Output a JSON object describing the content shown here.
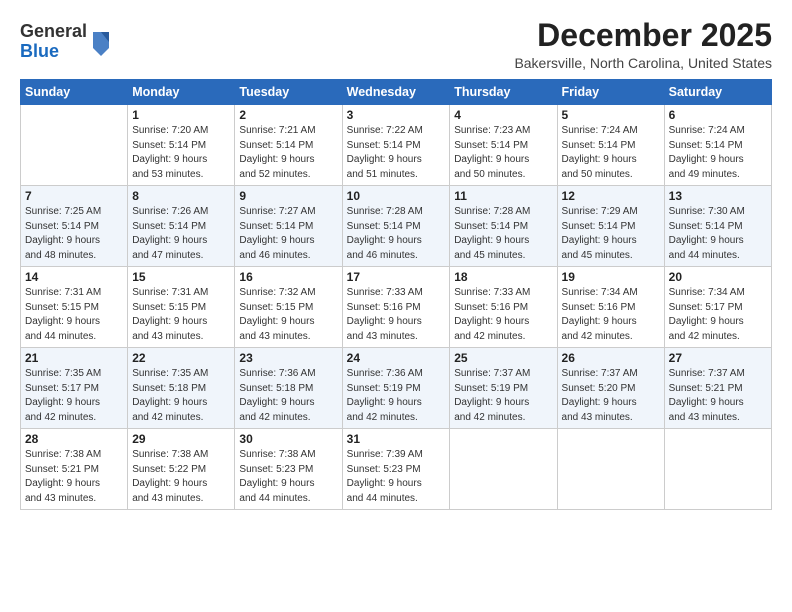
{
  "header": {
    "logo_general": "General",
    "logo_blue": "Blue",
    "month_title": "December 2025",
    "location": "Bakersville, North Carolina, United States"
  },
  "weekdays": [
    "Sunday",
    "Monday",
    "Tuesday",
    "Wednesday",
    "Thursday",
    "Friday",
    "Saturday"
  ],
  "weeks": [
    [
      {
        "day": "",
        "info": ""
      },
      {
        "day": "1",
        "info": "Sunrise: 7:20 AM\nSunset: 5:14 PM\nDaylight: 9 hours\nand 53 minutes."
      },
      {
        "day": "2",
        "info": "Sunrise: 7:21 AM\nSunset: 5:14 PM\nDaylight: 9 hours\nand 52 minutes."
      },
      {
        "day": "3",
        "info": "Sunrise: 7:22 AM\nSunset: 5:14 PM\nDaylight: 9 hours\nand 51 minutes."
      },
      {
        "day": "4",
        "info": "Sunrise: 7:23 AM\nSunset: 5:14 PM\nDaylight: 9 hours\nand 50 minutes."
      },
      {
        "day": "5",
        "info": "Sunrise: 7:24 AM\nSunset: 5:14 PM\nDaylight: 9 hours\nand 50 minutes."
      },
      {
        "day": "6",
        "info": "Sunrise: 7:24 AM\nSunset: 5:14 PM\nDaylight: 9 hours\nand 49 minutes."
      }
    ],
    [
      {
        "day": "7",
        "info": "Sunrise: 7:25 AM\nSunset: 5:14 PM\nDaylight: 9 hours\nand 48 minutes."
      },
      {
        "day": "8",
        "info": "Sunrise: 7:26 AM\nSunset: 5:14 PM\nDaylight: 9 hours\nand 47 minutes."
      },
      {
        "day": "9",
        "info": "Sunrise: 7:27 AM\nSunset: 5:14 PM\nDaylight: 9 hours\nand 46 minutes."
      },
      {
        "day": "10",
        "info": "Sunrise: 7:28 AM\nSunset: 5:14 PM\nDaylight: 9 hours\nand 46 minutes."
      },
      {
        "day": "11",
        "info": "Sunrise: 7:28 AM\nSunset: 5:14 PM\nDaylight: 9 hours\nand 45 minutes."
      },
      {
        "day": "12",
        "info": "Sunrise: 7:29 AM\nSunset: 5:14 PM\nDaylight: 9 hours\nand 45 minutes."
      },
      {
        "day": "13",
        "info": "Sunrise: 7:30 AM\nSunset: 5:14 PM\nDaylight: 9 hours\nand 44 minutes."
      }
    ],
    [
      {
        "day": "14",
        "info": "Sunrise: 7:31 AM\nSunset: 5:15 PM\nDaylight: 9 hours\nand 44 minutes."
      },
      {
        "day": "15",
        "info": "Sunrise: 7:31 AM\nSunset: 5:15 PM\nDaylight: 9 hours\nand 43 minutes."
      },
      {
        "day": "16",
        "info": "Sunrise: 7:32 AM\nSunset: 5:15 PM\nDaylight: 9 hours\nand 43 minutes."
      },
      {
        "day": "17",
        "info": "Sunrise: 7:33 AM\nSunset: 5:16 PM\nDaylight: 9 hours\nand 43 minutes."
      },
      {
        "day": "18",
        "info": "Sunrise: 7:33 AM\nSunset: 5:16 PM\nDaylight: 9 hours\nand 42 minutes."
      },
      {
        "day": "19",
        "info": "Sunrise: 7:34 AM\nSunset: 5:16 PM\nDaylight: 9 hours\nand 42 minutes."
      },
      {
        "day": "20",
        "info": "Sunrise: 7:34 AM\nSunset: 5:17 PM\nDaylight: 9 hours\nand 42 minutes."
      }
    ],
    [
      {
        "day": "21",
        "info": "Sunrise: 7:35 AM\nSunset: 5:17 PM\nDaylight: 9 hours\nand 42 minutes."
      },
      {
        "day": "22",
        "info": "Sunrise: 7:35 AM\nSunset: 5:18 PM\nDaylight: 9 hours\nand 42 minutes."
      },
      {
        "day": "23",
        "info": "Sunrise: 7:36 AM\nSunset: 5:18 PM\nDaylight: 9 hours\nand 42 minutes."
      },
      {
        "day": "24",
        "info": "Sunrise: 7:36 AM\nSunset: 5:19 PM\nDaylight: 9 hours\nand 42 minutes."
      },
      {
        "day": "25",
        "info": "Sunrise: 7:37 AM\nSunset: 5:19 PM\nDaylight: 9 hours\nand 42 minutes."
      },
      {
        "day": "26",
        "info": "Sunrise: 7:37 AM\nSunset: 5:20 PM\nDaylight: 9 hours\nand 43 minutes."
      },
      {
        "day": "27",
        "info": "Sunrise: 7:37 AM\nSunset: 5:21 PM\nDaylight: 9 hours\nand 43 minutes."
      }
    ],
    [
      {
        "day": "28",
        "info": "Sunrise: 7:38 AM\nSunset: 5:21 PM\nDaylight: 9 hours\nand 43 minutes."
      },
      {
        "day": "29",
        "info": "Sunrise: 7:38 AM\nSunset: 5:22 PM\nDaylight: 9 hours\nand 43 minutes."
      },
      {
        "day": "30",
        "info": "Sunrise: 7:38 AM\nSunset: 5:23 PM\nDaylight: 9 hours\nand 44 minutes."
      },
      {
        "day": "31",
        "info": "Sunrise: 7:39 AM\nSunset: 5:23 PM\nDaylight: 9 hours\nand 44 minutes."
      },
      {
        "day": "",
        "info": ""
      },
      {
        "day": "",
        "info": ""
      },
      {
        "day": "",
        "info": ""
      }
    ]
  ]
}
